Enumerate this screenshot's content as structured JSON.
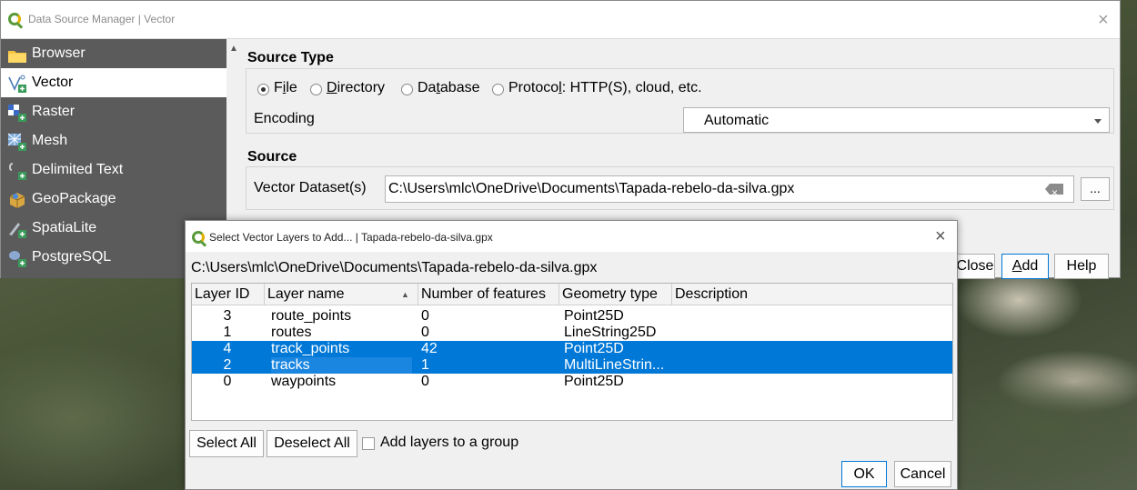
{
  "main_window": {
    "title": "Data Source Manager | Vector",
    "sidebar": {
      "items": [
        {
          "label": "Browser",
          "icon": "folder-icon"
        },
        {
          "label": "Vector",
          "icon": "vector-layer-icon"
        },
        {
          "label": "Raster",
          "icon": "raster-layer-icon"
        },
        {
          "label": "Mesh",
          "icon": "mesh-layer-icon"
        },
        {
          "label": "Delimited Text",
          "icon": "delimited-text-icon"
        },
        {
          "label": "GeoPackage",
          "icon": "geopackage-icon"
        },
        {
          "label": "SpatiaLite",
          "icon": "spatialite-icon"
        },
        {
          "label": "PostgreSQL",
          "icon": "postgresql-icon"
        }
      ],
      "selected": "Vector"
    },
    "source_type": {
      "title": "Source Type",
      "options": [
        {
          "label": "File",
          "checked": true
        },
        {
          "label": "Directory",
          "checked": false
        },
        {
          "label": "Database",
          "checked": false
        },
        {
          "label": "Protocol: HTTP(S), cloud, etc.",
          "checked": false
        }
      ],
      "encoding_label": "Encoding",
      "encoding_value": "Automatic"
    },
    "source": {
      "title": "Source",
      "dataset_label": "Vector Dataset(s)",
      "dataset_value": "C:\\Users\\mlc\\OneDrive\\Documents\\Tapada-rebelo-da-silva.gpx",
      "browse_label": "..."
    },
    "buttons": {
      "close": "Close",
      "add": "Add",
      "help": "Help"
    }
  },
  "dialog": {
    "title": "Select Vector Layers to Add... | Tapada-rebelo-da-silva.gpx",
    "path": "C:\\Users\\mlc\\OneDrive\\Documents\\Tapada-rebelo-da-silva.gpx",
    "columns": [
      "Layer ID",
      "Layer name",
      "Number of features",
      "Geometry type",
      "Description"
    ],
    "rows": [
      {
        "id": "3",
        "name": "route_points",
        "count": "0",
        "geom": "Point25D",
        "desc": "",
        "selected": false
      },
      {
        "id": "1",
        "name": "routes",
        "count": "0",
        "geom": "LineString25D",
        "desc": "",
        "selected": false
      },
      {
        "id": "4",
        "name": "track_points",
        "count": "42",
        "geom": "Point25D",
        "desc": "",
        "selected": true
      },
      {
        "id": "2",
        "name": "tracks",
        "count": "1",
        "geom": "MultiLineStrin...",
        "desc": "",
        "selected": true
      },
      {
        "id": "0",
        "name": "waypoints",
        "count": "0",
        "geom": "Point25D",
        "desc": "",
        "selected": false
      }
    ],
    "select_all": "Select All",
    "deselect_all": "Deselect All",
    "add_to_group": "Add layers to a group",
    "ok": "OK",
    "cancel": "Cancel"
  },
  "colors": {
    "selection": "#0078d7",
    "sidebar": "#5b5b5b",
    "qgis_green": "#5a9a3a"
  }
}
